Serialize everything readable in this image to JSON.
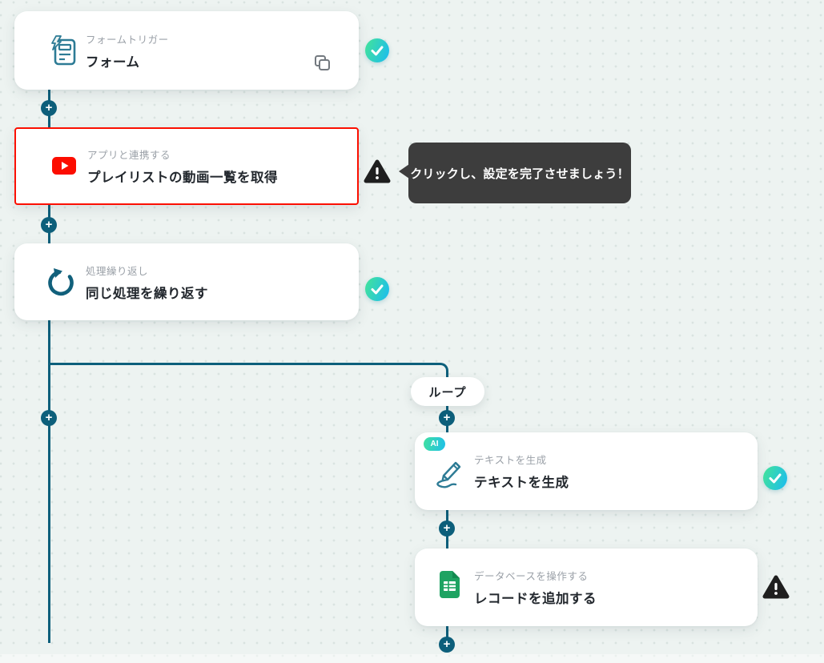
{
  "workflow": {
    "nodes": [
      {
        "category": "フォームトリガー",
        "title": "フォーム",
        "icon": "form-trigger-icon",
        "status": "complete",
        "has_copy_button": true
      },
      {
        "category": "アプリと連携する",
        "title": "プレイリストの動画一覧を取得",
        "icon": "youtube-icon",
        "status": "warning",
        "selected": true
      },
      {
        "category": "処理繰り返し",
        "title": "同じ処理を繰り返す",
        "icon": "loop-icon",
        "status": "complete"
      },
      {
        "category": "テキストを生成",
        "title": "テキストを生成",
        "icon": "ai-pencil-icon",
        "badge": "AI",
        "status": "complete"
      },
      {
        "category": "データベースを操作する",
        "title": "レコードを追加する",
        "icon": "google-sheets-icon",
        "status": "warning"
      }
    ],
    "loop_branch_label": "ループ",
    "tooltip_text": "クリックし、設定を完了させましょう！"
  },
  "colors": {
    "canvas_background": "#edf3f1",
    "dot_grid": "#d9e3e0",
    "connector": "#0d5f7b",
    "selected_border_red": "#fb0f00",
    "youtube_red": "#fc0d00",
    "status_gradient_start": "#40e0a0",
    "status_gradient_end": "#1ebfe9",
    "warning_black": "#1f1f1f",
    "tooltip_background": "#3d3d3d",
    "category_text": "#9ba1a8",
    "title_text": "#23282e",
    "icon_teal": "#2d7b95",
    "sheets_green": "#1ea362"
  }
}
